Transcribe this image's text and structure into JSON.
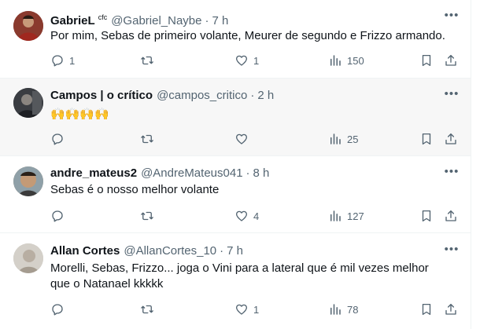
{
  "tweets": [
    {
      "name": "GabrieL",
      "badge": "cfc",
      "handle": "@Gabriel_Naybe",
      "dot": "·",
      "time": "7 h",
      "text": "Por mim, Sebas de primeiro volante, Meurer de segundo e Frizzo armando.",
      "replies": "1",
      "retweets": "",
      "likes": "1",
      "views": "150",
      "avatar_color": "#7a2a26"
    },
    {
      "name": "Campos | o crítico",
      "handle": "@campos_critico",
      "dot": "·",
      "time": "2 h",
      "text": "🙌🙌🙌🙌",
      "replies": "",
      "retweets": "",
      "likes": "",
      "views": "25",
      "avatar_color": "#2f3236"
    },
    {
      "name": "andre_mateus2",
      "handle": "@AndreMateus041",
      "dot": "·",
      "time": "8 h",
      "text": "Sebas é o nosso melhor volante",
      "replies": "",
      "retweets": "",
      "likes": "4",
      "views": "127",
      "avatar_color": "#a98a6a"
    },
    {
      "name": "Allan Cortes",
      "handle": "@AllanCortes_10",
      "dot": "·",
      "time": "7 h",
      "text": "Morelli, Sebas, Frizzo... joga o Vini para a lateral que é mil vezes melhor que o Natanael kkkkk",
      "replies": "",
      "retweets": "",
      "likes": "1",
      "views": "78",
      "avatar_color": "#c8c4bd"
    }
  ],
  "icons": {
    "more": "more-icon",
    "reply": "reply-icon",
    "retweet": "retweet-icon",
    "like": "like-icon",
    "views": "views-icon",
    "bookmark": "bookmark-icon",
    "share": "share-icon"
  },
  "colors": {
    "text": "#0f1419",
    "secondary": "#536471",
    "divider": "#eff3f4"
  }
}
